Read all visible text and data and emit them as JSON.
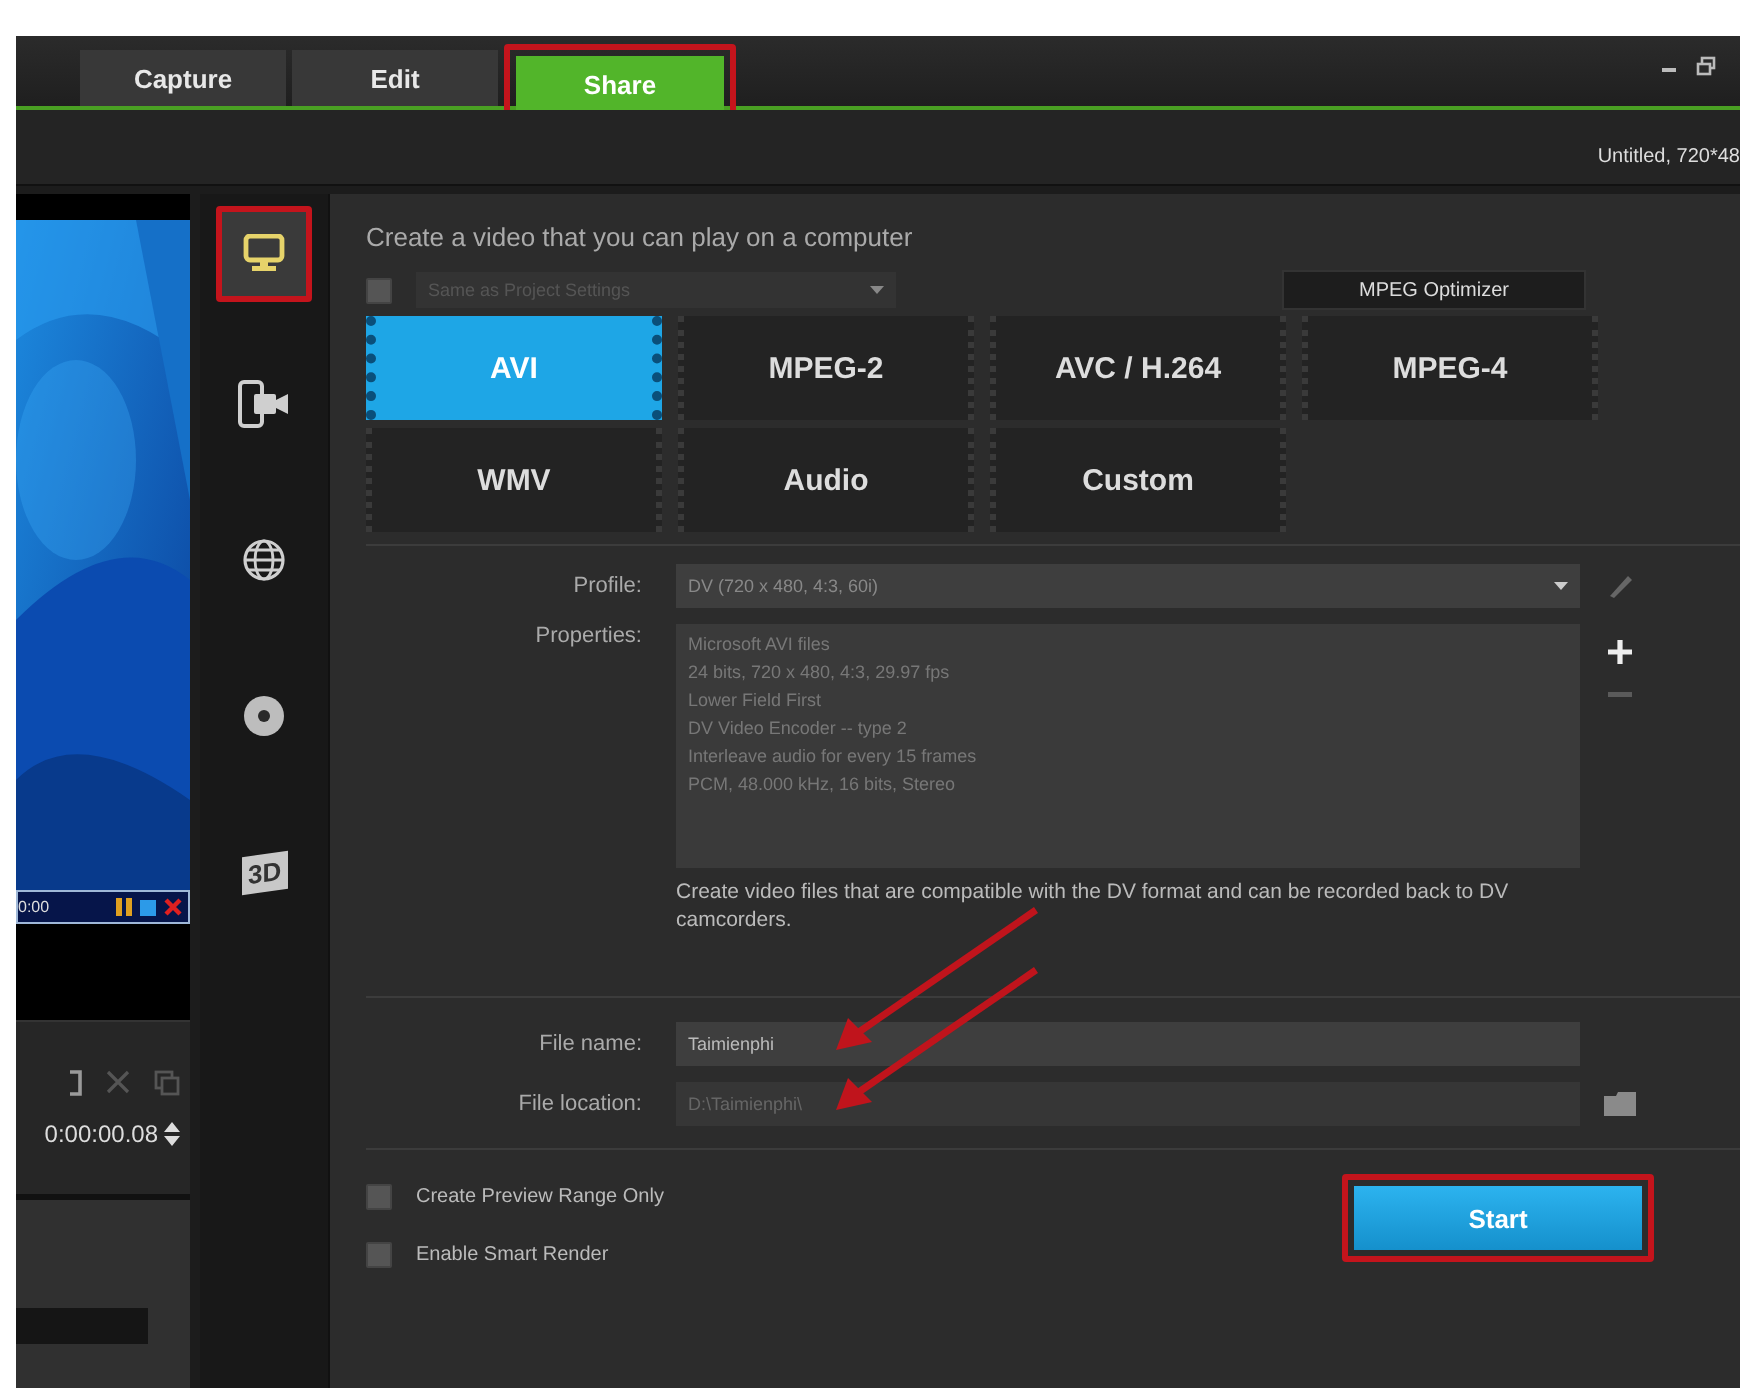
{
  "tabs": [
    {
      "label": "Capture",
      "selected": false,
      "highlighted": false
    },
    {
      "label": "Edit",
      "selected": false,
      "highlighted": false
    },
    {
      "label": "Share",
      "selected": true,
      "highlighted": true
    }
  ],
  "project_info": "Untitled, 720*48",
  "preview": {
    "kind": "picture",
    "overlay_time": "0:00",
    "timecode": "0:00:00.08"
  },
  "share_categories": [
    {
      "kind": "computer",
      "selected": true,
      "highlighted": true
    },
    {
      "kind": "device",
      "selected": false,
      "highlighted": false
    },
    {
      "kind": "web",
      "selected": false,
      "highlighted": false
    },
    {
      "kind": "disc",
      "selected": false,
      "highlighted": false
    },
    {
      "kind": "threed",
      "label": "3D",
      "selected": false,
      "highlighted": false
    }
  ],
  "heading": "Create a video that you can play on a computer",
  "same_as_project": {
    "label": "Same as Project Settings",
    "checked": false,
    "disabled": true
  },
  "mpeg_optimizer": "MPEG Optimizer",
  "formats": [
    {
      "label": "AVI",
      "selected": true
    },
    {
      "label": "MPEG-2",
      "selected": false
    },
    {
      "label": "AVC / H.264",
      "selected": false
    },
    {
      "label": "MPEG-4",
      "selected": false
    },
    {
      "label": "WMV",
      "selected": false
    },
    {
      "label": "Audio",
      "selected": false
    },
    {
      "label": "Custom",
      "selected": false
    }
  ],
  "profile": {
    "label": "Profile:",
    "value": "DV (720 x 480, 4:3, 60i)"
  },
  "properties": {
    "label": "Properties:",
    "lines": [
      "Microsoft AVI files",
      "24 bits, 720 x 480, 4:3, 29.97 fps",
      "Lower Field First",
      "DV Video Encoder -- type 2",
      "Interleave audio for every 15 frames",
      "PCM, 48.000 kHz, 16 bits, Stereo"
    ]
  },
  "description": "Create video files that are compatible with the DV format and can be recorded back to DV camcorders.",
  "file_name": {
    "label": "File name:",
    "value": "Taimienphi",
    "disabled": false,
    "pointed": true
  },
  "file_location": {
    "label": "File location:",
    "value": "D:\\Taimienphi\\",
    "disabled": true,
    "pointed": true
  },
  "options": [
    {
      "label": "Create Preview Range Only",
      "checked": false
    },
    {
      "label": "Enable Smart Render",
      "checked": false
    }
  ],
  "start_button": {
    "label": "Start",
    "highlighted": true
  }
}
